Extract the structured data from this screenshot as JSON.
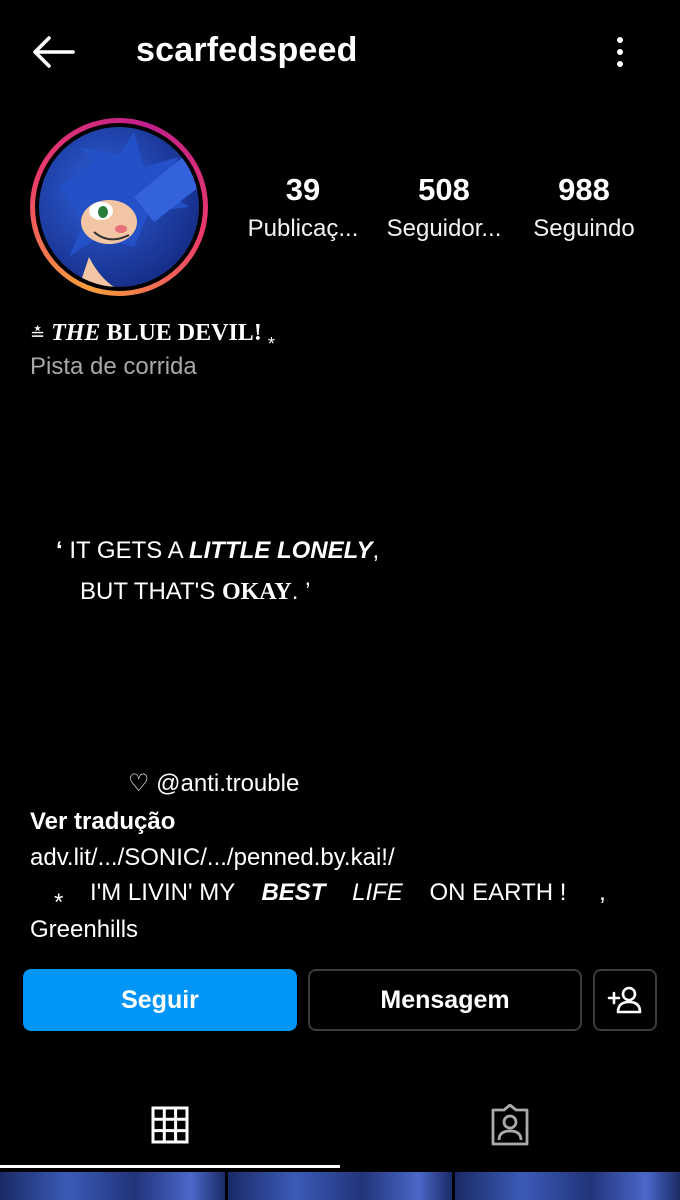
{
  "header": {
    "username": "scarfedspeed",
    "back_icon": "arrow-left-icon",
    "more_icon": "more-vertical-icon"
  },
  "stats": [
    {
      "value": "39",
      "label": "Publicaç..."
    },
    {
      "value": "508",
      "label": "Seguidor..."
    },
    {
      "value": "988",
      "label": "Seguindo"
    }
  ],
  "bio": {
    "name_prefix": "≛",
    "name_the": "THE",
    "name_rest": "BLUE DEVIL!",
    "name_suffix": "*",
    "category": "Pista de corrida",
    "quote_open": "‘",
    "quote_part1": " IT GETS A ",
    "quote_bold": "LITTLE LONELY",
    "quote_part2": ",",
    "quote2_part1": "BUT THAT'S ",
    "quote2_okay": "OKAY",
    "quote2_end": ". ’",
    "heart_line": "♡ @anti.trouble",
    "see_translation": "Ver tradução",
    "link": "adv.lit/.../SONIC/.../penned.by.kai!/",
    "livin_star": "*",
    "livin_part1": "I'M LIVIN' MY",
    "livin_best": "BEST",
    "livin_life": "LIFE",
    "livin_part2": "ON EARTH !",
    "livin_comma": ",",
    "location": "Greenhills"
  },
  "actions": {
    "follow": "Seguir",
    "message": "Mensagem",
    "add_user_icon": "add-user-icon"
  },
  "tabs": [
    {
      "name": "posts-grid",
      "icon": "grid-icon",
      "active": true
    },
    {
      "name": "tagged",
      "icon": "tagged-person-icon",
      "active": false
    }
  ],
  "colors": {
    "background": "#000000",
    "follow_button": "#0095f6",
    "secondary_text": "#a8a8a8",
    "button_border": "#3c3c3c"
  }
}
